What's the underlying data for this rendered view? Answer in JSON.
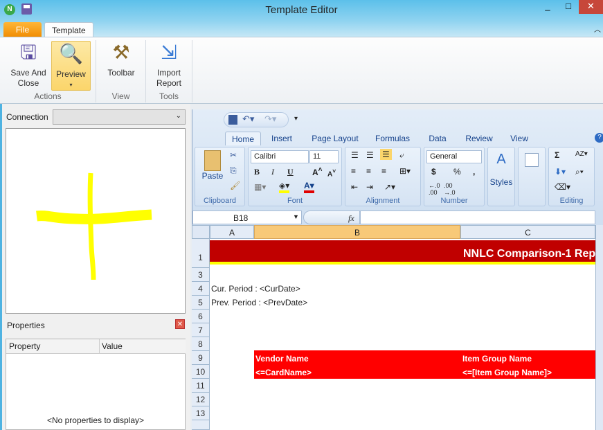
{
  "window": {
    "title": "Template Editor",
    "app_icon": "n-logo-icon",
    "controls": [
      "_",
      "□",
      "✕"
    ]
  },
  "menu_tabs": [
    {
      "label": "File",
      "active": false
    },
    {
      "label": "Template",
      "active": true
    }
  ],
  "ribbon": {
    "buttons": [
      {
        "label1": "Save And",
        "label2": "Close",
        "icon": "save-close-icon"
      },
      {
        "label1": "Preview",
        "label2": "▾",
        "icon": "preview-icon",
        "highlighted": true
      },
      {
        "label1": "Toolbar",
        "label2": "",
        "icon": "toolbar-tools-icon"
      },
      {
        "label1": "Import",
        "label2": "Report",
        "icon": "import-report-icon"
      }
    ],
    "groups": [
      "Actions",
      "View",
      "Tools"
    ]
  },
  "left_panel": {
    "connection_label": "Connection",
    "connection_value": "",
    "properties_title": "Properties",
    "columns": [
      "Property",
      "Value"
    ],
    "empty_text": "<No properties to display>",
    "drawing_color": "#ffff00"
  },
  "excel": {
    "tabs": [
      "Home",
      "Insert",
      "Page Layout",
      "Formulas",
      "Data",
      "Review",
      "View"
    ],
    "active_tab": "Home",
    "clipboard": {
      "paste": "Paste",
      "label": "Clipboard"
    },
    "font": {
      "name": "Calibri",
      "size": "11",
      "label": "Font",
      "bold": "B",
      "italic": "I",
      "underline": "U"
    },
    "alignment": {
      "label": "Alignment"
    },
    "number": {
      "format": "General",
      "label": "Number",
      "currency": "$",
      "percent": "%",
      "comma": ","
    },
    "styles": {
      "label": "Styles"
    },
    "cells": {
      "title": "NNLC Comparison-1 Rep",
      "cur_period": "Cur. Period : <CurDate>",
      "prev_period": "Prev. Period : <PrevDate>",
      "vendor_header": "Vendor Name",
      "item_group_header": "Item Group Name",
      "vendor_value": "<=CardName>",
      "item_group_value": "<=[Item Group Name]>"
    },
    "editing": {
      "label": "Editing",
      "sum": "Σ"
    },
    "name_box": "B18",
    "fx": "fx",
    "formula": "",
    "columns": [
      "A",
      "B",
      "C"
    ],
    "selected_column": "B",
    "rows": [
      "1",
      "3",
      "4",
      "5",
      "6",
      "7",
      "8",
      "9",
      "10",
      "11",
      "12",
      "13"
    ],
    "colors": {
      "title_bg": "#c00000",
      "table_bg": "#ff0000",
      "accent_line": "#ffff00"
    }
  }
}
